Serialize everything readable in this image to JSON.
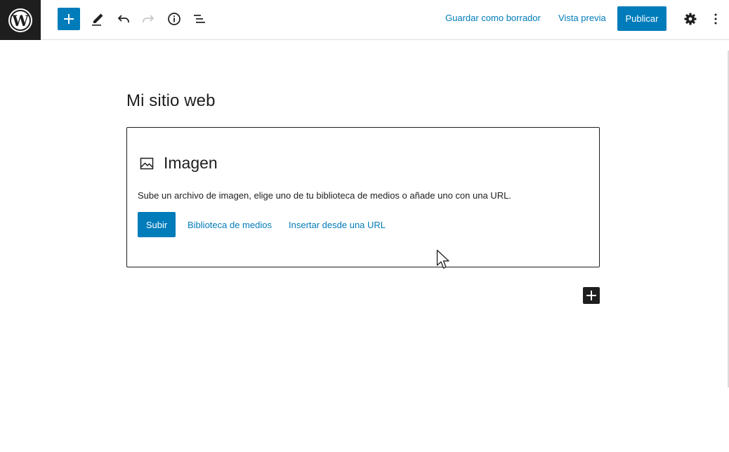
{
  "toolbar": {
    "logo_icon": "wordpress-logo-icon",
    "add_block_icon": "plus-icon",
    "tools_icon": "pencil-icon",
    "undo_icon": "undo-icon",
    "redo_icon": "redo-icon",
    "details_icon": "info-icon",
    "outline_icon": "list-view-icon",
    "save_draft_label": "Guardar como borrador",
    "preview_label": "Vista previa",
    "publish_label": "Publicar",
    "settings_icon": "gear-icon",
    "options_icon": "more-vertical-icon"
  },
  "editor": {
    "post_title": "Mi sitio web",
    "image_block": {
      "icon": "image-icon",
      "label": "Imagen",
      "instructions": "Sube un archivo de imagen, elige uno de tu biblioteca de medios o añade uno con una URL.",
      "upload_label": "Subir",
      "media_library_label": "Biblioteca de medios",
      "insert_url_label": "Insertar desde una URL"
    },
    "add_block_icon": "plus-icon"
  },
  "colors": {
    "accent": "#007cba",
    "dark": "#1e1e1e",
    "background": "#ffffff"
  }
}
